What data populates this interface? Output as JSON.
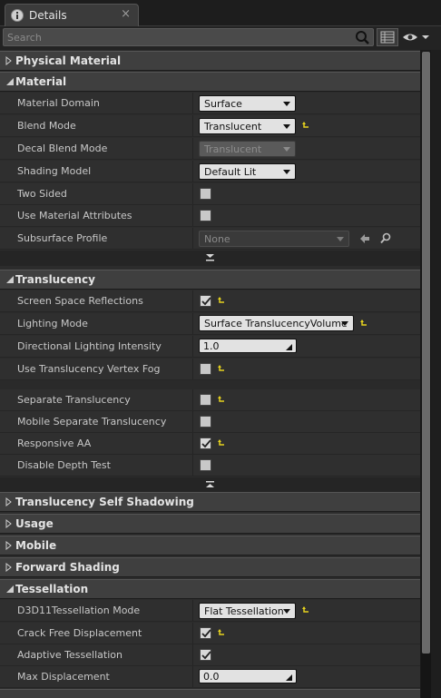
{
  "tab": {
    "title": "Details",
    "close": "×",
    "icon": "info-icon"
  },
  "search": {
    "placeholder": "Search",
    "value": ""
  },
  "categories": {
    "physical_material": "Physical Material",
    "material": "Material",
    "translucency": "Translucency",
    "translucency_self_shadowing": "Translucency Self Shadowing",
    "usage": "Usage",
    "mobile": "Mobile",
    "forward_shading": "Forward Shading",
    "tessellation": "Tessellation"
  },
  "material": {
    "domain": {
      "label": "Material Domain",
      "value": "Surface"
    },
    "blend_mode": {
      "label": "Blend Mode",
      "value": "Translucent"
    },
    "decal_blend_mode": {
      "label": "Decal Blend Mode",
      "value": "Translucent"
    },
    "shading_model": {
      "label": "Shading Model",
      "value": "Default Lit"
    },
    "two_sided": {
      "label": "Two Sided",
      "checked": false
    },
    "use_material_attributes": {
      "label": "Use Material Attributes",
      "checked": false
    },
    "subsurface_profile": {
      "label": "Subsurface Profile",
      "value": "None"
    }
  },
  "translucency": {
    "ssr": {
      "label": "Screen Space Reflections",
      "checked": true
    },
    "lighting_mode": {
      "label": "Lighting Mode",
      "value": "Surface TranslucencyVolume"
    },
    "directional_intensity": {
      "label": "Directional Lighting Intensity",
      "value": "1.0"
    },
    "vertex_fog": {
      "label": "Use Translucency Vertex Fog",
      "checked": false
    },
    "separate": {
      "label": "Separate Translucency",
      "checked": false
    },
    "mobile_separate": {
      "label": "Mobile Separate Translucency",
      "checked": false
    },
    "responsive_aa": {
      "label": "Responsive AA",
      "checked": true
    },
    "disable_depth": {
      "label": "Disable Depth Test",
      "checked": false
    }
  },
  "tessellation": {
    "mode": {
      "label": "D3D11Tessellation Mode",
      "value": "Flat Tessellation"
    },
    "crack_free": {
      "label": "Crack Free Displacement",
      "checked": true
    },
    "adaptive": {
      "label": "Adaptive Tessellation",
      "checked": true
    },
    "max_displacement": {
      "label": "Max Displacement",
      "value": "0.0"
    }
  },
  "colors": {
    "reset_arrow": "#e6d21e",
    "panel_bg": "#2f2f2f",
    "category_bg": "#3f3f3f"
  }
}
